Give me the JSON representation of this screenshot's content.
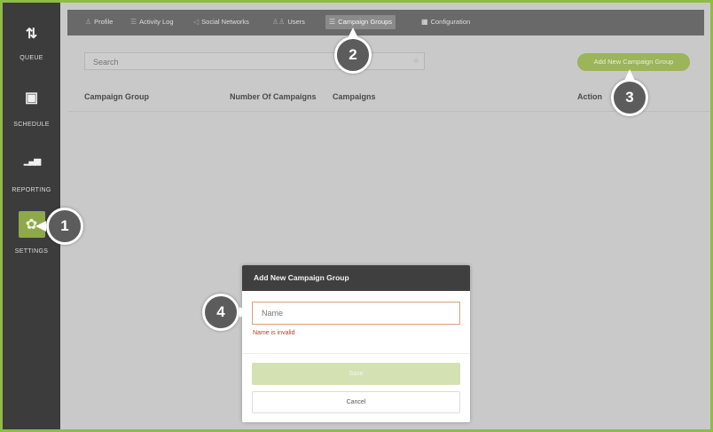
{
  "sidebar": {
    "items": [
      {
        "icon": "swap-arrows-icon",
        "glyph": "⇅",
        "label": "QUEUE"
      },
      {
        "icon": "calendar-icon",
        "glyph": "▣",
        "label": "SCHEDULE"
      },
      {
        "icon": "bar-chart-icon",
        "glyph": "▁▃▅",
        "label": "REPORTING"
      },
      {
        "icon": "gear-icon",
        "glyph": "✿",
        "label": "SETTINGS"
      }
    ]
  },
  "nav": {
    "items": [
      {
        "label": "Profile",
        "glyph": "♙"
      },
      {
        "label": "Activity Log",
        "glyph": "☰"
      },
      {
        "label": "Social Networks",
        "glyph": "◁"
      },
      {
        "label": "Users",
        "glyph": "♙♙"
      },
      {
        "label": "Campaign Groups",
        "glyph": "☰"
      },
      {
        "label": "Configuration",
        "glyph": "▦"
      }
    ]
  },
  "search": {
    "placeholder": "Search"
  },
  "add_button": "Add New Campaign Group",
  "table": {
    "headers": [
      "Campaign Group",
      "Number Of Campaigns",
      "Campaigns",
      "Action"
    ]
  },
  "modal": {
    "title": "Add New Campaign Group",
    "name_placeholder": "Name",
    "error": "Name is invalid",
    "save": "Save",
    "cancel": "Cancel"
  },
  "callouts": [
    "1",
    "2",
    "3",
    "4"
  ],
  "colors": {
    "accent": "#8fbc45",
    "sidebar": "#3c3c3c",
    "button": "#9cb45a",
    "error": "#c0392b"
  }
}
